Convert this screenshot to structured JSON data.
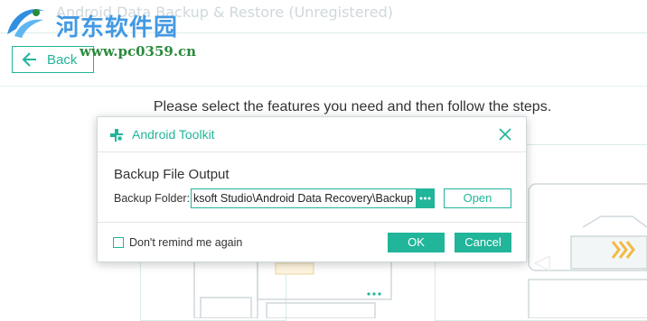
{
  "app": {
    "title": "Android Data Backup & Restore (Unregistered)",
    "watermark_text": "河东软件园",
    "watermark_url": "www.pc0359.cn",
    "back_label": "Back",
    "instructions": "Please select the features you need and then follow the steps."
  },
  "dialog": {
    "title": "Android Toolkit",
    "section_title": "Backup File Output",
    "folder_label": "Backup Folder:",
    "folder_value": "ksoft Studio\\Android Data Recovery\\Backup",
    "browse_icon": "ellipsis-icon",
    "open_label": "Open",
    "checkbox_label": "Don't remind me again",
    "checkbox_checked": false,
    "ok_label": "OK",
    "cancel_label": "Cancel"
  },
  "colors": {
    "accent": "#21b59a",
    "watermark_blue": "#2f8fe0",
    "watermark_green": "#2a8a3c",
    "card_border": "#d8ecea"
  }
}
